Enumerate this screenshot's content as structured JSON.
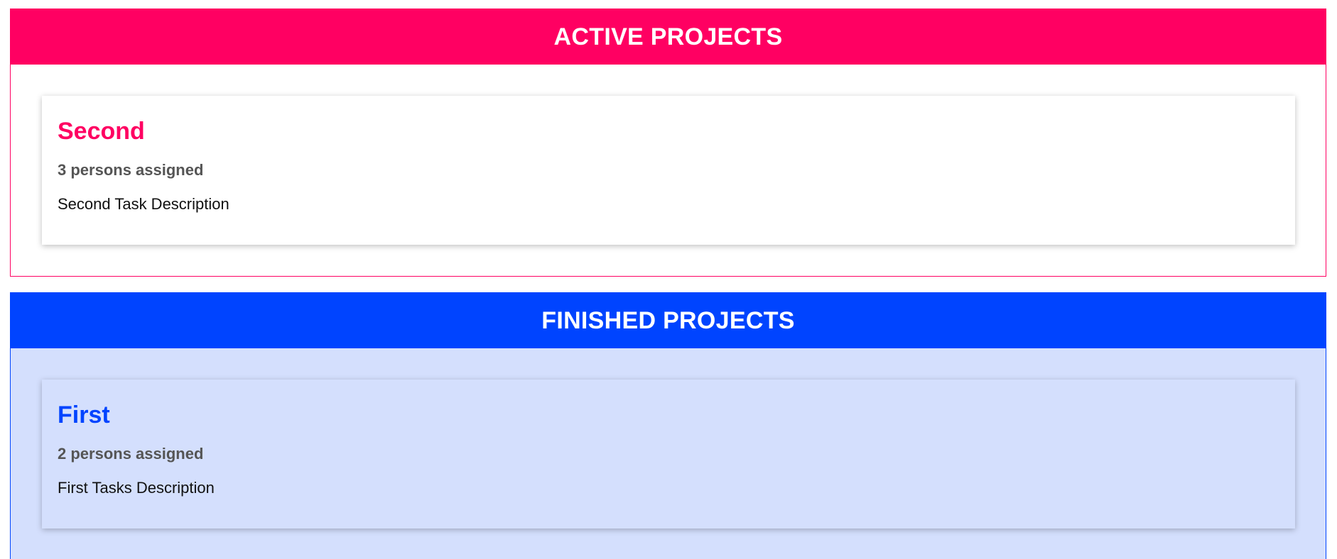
{
  "active_projects": {
    "header": "ACTIVE PROJECTS",
    "accent_color": "#ff0062",
    "projects": [
      {
        "title": "Second",
        "assigned": "3 persons assigned",
        "description": "Second Task Description"
      }
    ]
  },
  "finished_projects": {
    "header": "FINISHED PROJECTS",
    "accent_color": "#0044ff",
    "projects": [
      {
        "title": "First",
        "assigned": "2 persons assigned",
        "description": "First Tasks Description"
      }
    ]
  }
}
